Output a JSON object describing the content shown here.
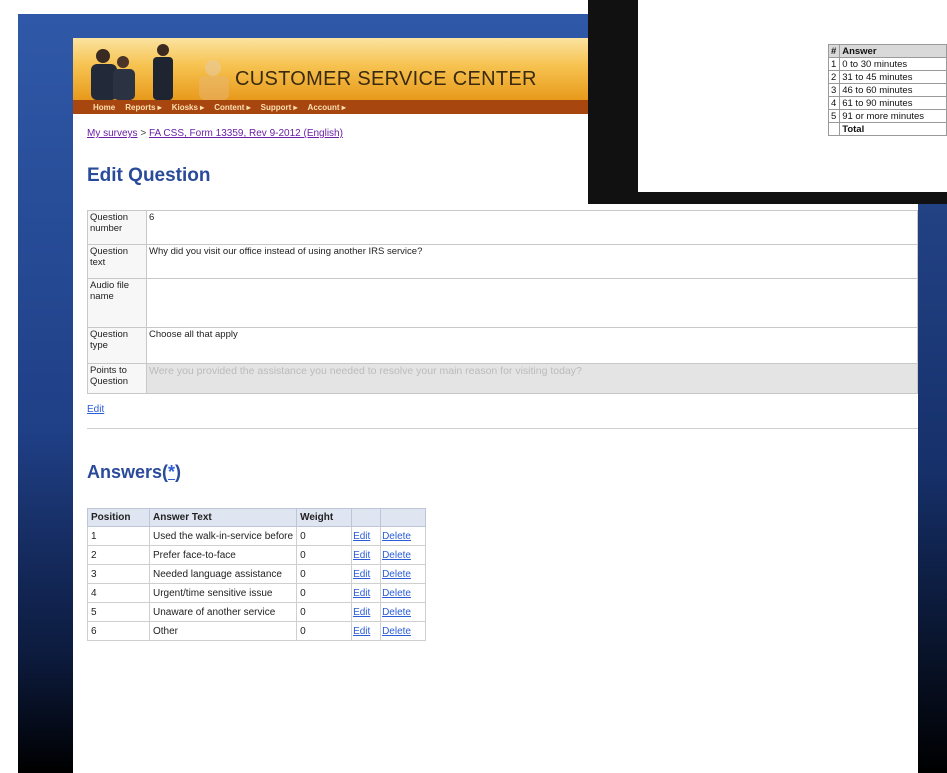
{
  "banner": {
    "title": "CUSTOMER SERVICE CENTER"
  },
  "nav": [
    {
      "label": "Home"
    },
    {
      "label": "Reports ▸"
    },
    {
      "label": "Kiosks ▸"
    },
    {
      "label": "Content ▸"
    },
    {
      "label": "Support ▸"
    },
    {
      "label": "Account ▸"
    }
  ],
  "breadcrumb": {
    "link1": "My surveys",
    "sep": " > ",
    "link2": "FA CSS, Form 13359, Rev 9-2012 (English)"
  },
  "edit_heading": "Edit Question",
  "question": {
    "rows": [
      {
        "key": "Question number",
        "value": "6"
      },
      {
        "key": "Question text",
        "value": "Why did you visit our office instead of using another IRS service?"
      },
      {
        "key": "Audio file name",
        "value": ""
      },
      {
        "key": "Question type",
        "value": "Choose all that apply"
      },
      {
        "key": "Points to Question",
        "value": "Were you provided the assistance you needed to resolve your main reason for visiting today?"
      }
    ],
    "edit_link": "Edit"
  },
  "answers": {
    "heading": "Answers(",
    "heading_link": "*",
    "heading_close": ")",
    "columns": [
      "Position",
      "Answer Text",
      "Weight",
      "",
      ""
    ],
    "rows": [
      {
        "position": "1",
        "text": "Used the walk-in-service before",
        "weight": "0",
        "edit": "Edit",
        "delete": "Delete"
      },
      {
        "position": "2",
        "text": "Prefer face-to-face",
        "weight": "0",
        "edit": "Edit",
        "delete": "Delete"
      },
      {
        "position": "3",
        "text": "Needed language assistance",
        "weight": "0",
        "edit": "Edit",
        "delete": "Delete"
      },
      {
        "position": "4",
        "text": "Urgent/time sensitive issue",
        "weight": "0",
        "edit": "Edit",
        "delete": "Delete"
      },
      {
        "position": "5",
        "text": "Unaware of another service",
        "weight": "0",
        "edit": "Edit",
        "delete": "Delete"
      },
      {
        "position": "6",
        "text": "Other",
        "weight": "0",
        "edit": "Edit",
        "delete": "Delete"
      }
    ]
  },
  "inset": {
    "columns": [
      "#",
      "Answer"
    ],
    "rows": [
      {
        "n": "1",
        "answer": "0 to 30 minutes"
      },
      {
        "n": "2",
        "answer": "31 to 45 minutes"
      },
      {
        "n": "3",
        "answer": "46 to 60 minutes"
      },
      {
        "n": "4",
        "answer": "61 to 90 minutes"
      },
      {
        "n": "5",
        "answer": "91 or more minutes"
      },
      {
        "n": "",
        "answer": "Total"
      }
    ]
  }
}
